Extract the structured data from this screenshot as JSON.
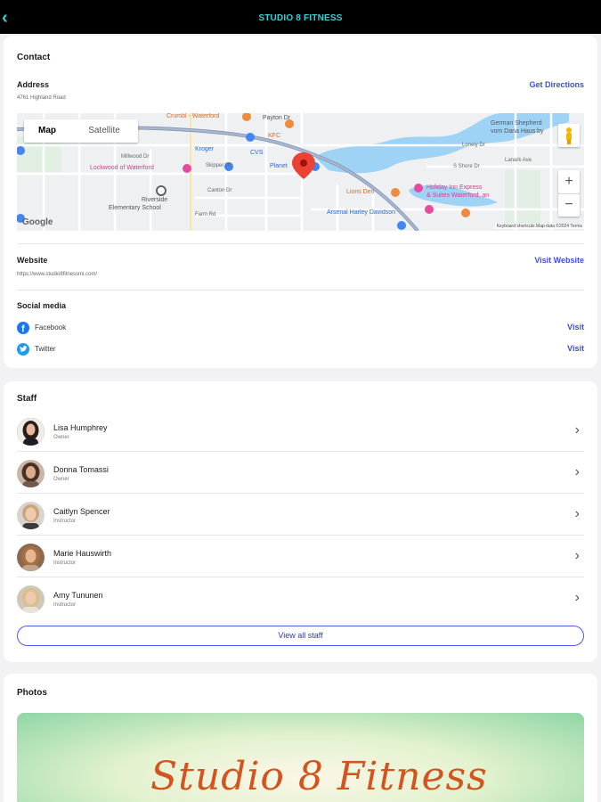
{
  "app": {
    "title": "STUDIO 8 FITNESS",
    "back_icon": "chevron-left-icon",
    "accent": "#2fd3d8"
  },
  "contact": {
    "section_title": "Contact",
    "address_label": "Address",
    "address_value": "4761 Highland Road",
    "directions_link": "Get Directions",
    "website_label": "Website",
    "website_value": "https://www.studio8fitnessmi.com/",
    "website_link": "Visit Website",
    "social_label": "Social media",
    "social": [
      {
        "name": "Facebook",
        "link": "Visit",
        "icon": "facebook-icon",
        "color": "#1877f2"
      },
      {
        "name": "Twitter",
        "link": "Visit",
        "icon": "twitter-icon",
        "color": "#1d9bf0"
      }
    ]
  },
  "map": {
    "tab_map": "Map",
    "tab_satellite": "Satellite",
    "zoom_in": "+",
    "zoom_out": "−",
    "logo": "Google",
    "attribution": "Keyboard shortcuts   Map data ©2024   Terms",
    "labels": {
      "crumbl": "Crumbl - Waterford",
      "payton": "Payton Dr",
      "german": "German Shepherd",
      "vom": "vom Dana Haus by",
      "kroger": "Kroger",
      "kfc": "KFC",
      "cvs": "CVS",
      "lockwood": "Lockwood of Waterford",
      "planet": "Planet",
      "millwood": "Millwood Dr",
      "shore": "S Shore Dr",
      "lonely": "Lonely Dr",
      "riverside1": "Riverside",
      "riverside2": "Elementary School",
      "lions": "Lions Den",
      "holiday1": "Holiday Inn Express",
      "holiday2": "& Suites Waterford, an",
      "arsenal": "Arsenal Harley Davidson",
      "farm": "Farm Rd",
      "canton": "Canton Dr",
      "skipper": "Skipper Dr",
      "lanark": "Lanark Ave"
    }
  },
  "staff": {
    "section_title": "Staff",
    "members": [
      {
        "name": "Lisa Humphrey",
        "role": "Owner"
      },
      {
        "name": "Donna Tomassi",
        "role": "Owner"
      },
      {
        "name": "Caitlyn Spencer",
        "role": "Instructor"
      },
      {
        "name": "Marie Hauswirth",
        "role": "Instructor"
      },
      {
        "name": "Amy Tununen",
        "role": "Instructor"
      }
    ],
    "view_all": "View all staff"
  },
  "photos": {
    "section_title": "Photos",
    "photo_text": "Studio 8 Fitness"
  }
}
